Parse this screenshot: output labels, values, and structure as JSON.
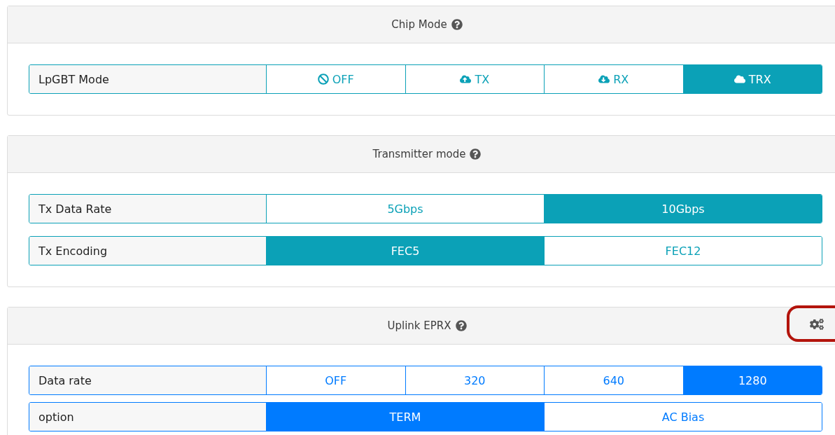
{
  "sections": [
    {
      "title": "Chip Mode",
      "kind": "info",
      "settings_button": false,
      "rows": [
        {
          "label": "LpGBT Mode",
          "options": [
            {
              "label": "OFF",
              "selected": false
            },
            {
              "label": "TX",
              "selected": false
            },
            {
              "label": "RX",
              "selected": false
            },
            {
              "label": "TRX",
              "selected": true
            }
          ]
        }
      ]
    },
    {
      "title": "Transmitter mode",
      "kind": "info",
      "settings_button": false,
      "rows": [
        {
          "label": "Tx Data Rate",
          "options": [
            {
              "label": "5Gbps",
              "selected": false
            },
            {
              "label": "10Gbps",
              "selected": true
            }
          ]
        },
        {
          "label": "Tx Encoding",
          "options": [
            {
              "label": "FEC5",
              "selected": true
            },
            {
              "label": "FEC12",
              "selected": false
            }
          ]
        }
      ]
    },
    {
      "title": "Uplink EPRX",
      "kind": "primary",
      "settings_button": true,
      "highlighted": true,
      "rows": [
        {
          "label": "Data rate",
          "options": [
            {
              "label": "OFF",
              "selected": false
            },
            {
              "label": "320",
              "selected": false
            },
            {
              "label": "640",
              "selected": false
            },
            {
              "label": "1280",
              "selected": true
            }
          ]
        },
        {
          "label": "option",
          "options": [
            {
              "label": "TERM",
              "selected": true
            },
            {
              "label": "AC Bias",
              "selected": false
            }
          ]
        }
      ]
    }
  ]
}
